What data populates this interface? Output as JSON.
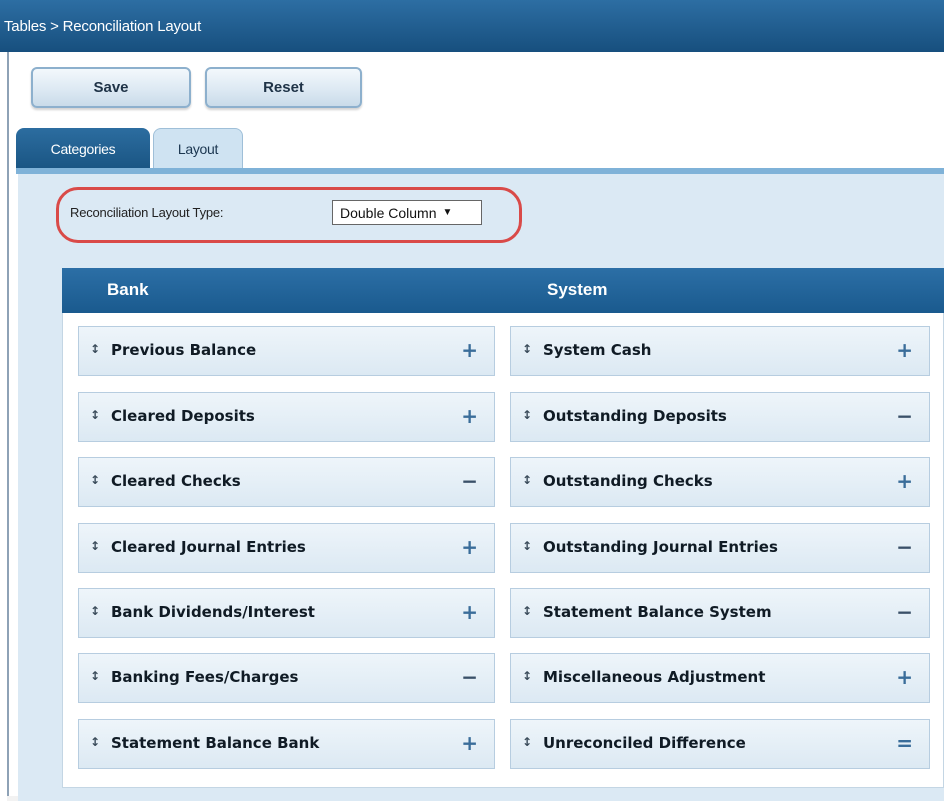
{
  "breadcrumb": "Tables > Reconciliation Layout",
  "toolbar": {
    "save_label": "Save",
    "reset_label": "Reset"
  },
  "tabs": [
    {
      "label": "Categories",
      "active": false
    },
    {
      "label": "Layout",
      "active": true
    }
  ],
  "layout_type": {
    "label": "Reconciliation Layout Type:",
    "selected": "Double Column",
    "arrow": "▼"
  },
  "grid": {
    "bank_header": "Bank",
    "system_header": "System",
    "drag_glyph": "↕",
    "bank_rows": [
      {
        "label": "Previous Balance",
        "sign": "+"
      },
      {
        "label": "Cleared Deposits",
        "sign": "+"
      },
      {
        "label": "Cleared Checks",
        "sign": "−"
      },
      {
        "label": "Cleared Journal Entries",
        "sign": "+"
      },
      {
        "label": "Bank Dividends/Interest",
        "sign": "+"
      },
      {
        "label": "Banking Fees/Charges",
        "sign": "−"
      },
      {
        "label": "Statement Balance Bank",
        "sign": "+"
      }
    ],
    "system_rows": [
      {
        "label": "System Cash",
        "sign": "+"
      },
      {
        "label": "Outstanding Deposits",
        "sign": "−"
      },
      {
        "label": "Outstanding Checks",
        "sign": "+"
      },
      {
        "label": "Outstanding Journal Entries",
        "sign": "−"
      },
      {
        "label": "Statement Balance System",
        "sign": "−"
      },
      {
        "label": "Miscellaneous Adjustment",
        "sign": "+"
      },
      {
        "label": "Unreconciled Difference",
        "sign": "="
      }
    ]
  },
  "colors": {
    "header_blue": "#1a5a8e",
    "highlight_ring": "#d94a48",
    "panel_bg": "#dbe9f4"
  }
}
